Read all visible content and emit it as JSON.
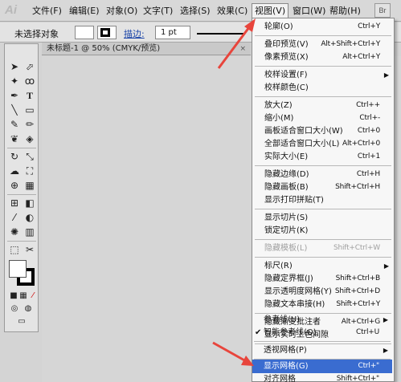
{
  "app": {
    "logo": "Ai"
  },
  "menubar": {
    "items": [
      {
        "label": "文件(F)"
      },
      {
        "label": "编辑(E)"
      },
      {
        "label": "对象(O)"
      },
      {
        "label": "文字(T)"
      },
      {
        "label": "选择(S)"
      },
      {
        "label": "效果(C)"
      },
      {
        "label": "视图(V)",
        "active": true
      },
      {
        "label": "窗口(W)"
      },
      {
        "label": "帮助(H)"
      }
    ],
    "bridge_label": "Br"
  },
  "controlbar": {
    "status": "未选择对象",
    "stroke_label": "描边:",
    "stroke_weight": "1 pt"
  },
  "document": {
    "tab_title": "未标题-1 @ 50% (CMYK/预览)",
    "close": "×"
  },
  "view_menu": {
    "items": [
      {
        "label": "轮廓(O)",
        "shortcut": "Ctrl+Y"
      },
      {
        "label": "叠印预览(V)",
        "shortcut": "Alt+Shift+Ctrl+Y"
      },
      {
        "label": "像素预览(X)",
        "shortcut": "Alt+Ctrl+Y"
      },
      {
        "label": "校样设置(F)",
        "submenu": true
      },
      {
        "label": "校样颜色(C)"
      },
      {
        "label": "放大(Z)",
        "shortcut": "Ctrl++"
      },
      {
        "label": "缩小(M)",
        "shortcut": "Ctrl+-"
      },
      {
        "label": "画板适合窗口大小(W)",
        "shortcut": "Ctrl+0"
      },
      {
        "label": "全部适合窗口大小(L)",
        "shortcut": "Alt+Ctrl+0"
      },
      {
        "label": "实际大小(E)",
        "shortcut": "Ctrl+1"
      },
      {
        "label": "隐藏边缘(D)",
        "shortcut": "Ctrl+H"
      },
      {
        "label": "隐藏画板(B)",
        "shortcut": "Shift+Ctrl+H"
      },
      {
        "label": "显示打印拼贴(T)"
      },
      {
        "label": "显示切片(S)"
      },
      {
        "label": "锁定切片(K)"
      },
      {
        "label": "隐藏模板(L)",
        "shortcut": "Shift+Ctrl+W",
        "disabled": true
      },
      {
        "label": "标尺(R)",
        "submenu": true
      },
      {
        "label": "隐藏定界框(J)",
        "shortcut": "Shift+Ctrl+B"
      },
      {
        "label": "显示透明度网格(Y)",
        "shortcut": "Shift+Ctrl+D"
      },
      {
        "label": "隐藏文本串接(H)",
        "shortcut": "Shift+Ctrl+Y"
      },
      {
        "label": "隐藏渐变批注者",
        "shortcut": "Alt+Ctrl+G"
      },
      {
        "label": "显示实时上色间隙"
      },
      {
        "label": "参考线(U)",
        "submenu": true
      },
      {
        "label": "智能参考线(Q)",
        "shortcut": "Ctrl+U",
        "checked": true
      },
      {
        "label": "透视网格(P)",
        "submenu": true
      },
      {
        "label": "显示网格(G)",
        "shortcut": "Ctrl+\"",
        "highlighted": true
      },
      {
        "label": "对齐网格",
        "shortcut": "Shift+Ctrl+\""
      }
    ],
    "checkmark": "✔",
    "submenu_arrow": "▶"
  },
  "tools": {
    "icons": [
      "selection-tool",
      "direct-selection-tool",
      "magic-wand-tool",
      "lasso-tool",
      "pen-tool",
      "type-tool",
      "line-segment-tool",
      "rectangle-tool",
      "paintbrush-tool",
      "pencil-tool",
      "blob-brush-tool",
      "eraser-tool",
      "rotate-tool",
      "scale-tool",
      "warp-tool",
      "free-transform-tool",
      "shape-builder-tool",
      "perspective-grid-tool",
      "mesh-tool",
      "gradient-tool",
      "eyedropper-tool",
      "blend-tool",
      "symbol-sprayer-tool",
      "column-graph-tool",
      "artboard-tool",
      "slice-tool",
      "hand-tool",
      "zoom-tool"
    ]
  },
  "colors": {
    "accent": "#3a6cd0",
    "arrow": "#e8453c"
  }
}
